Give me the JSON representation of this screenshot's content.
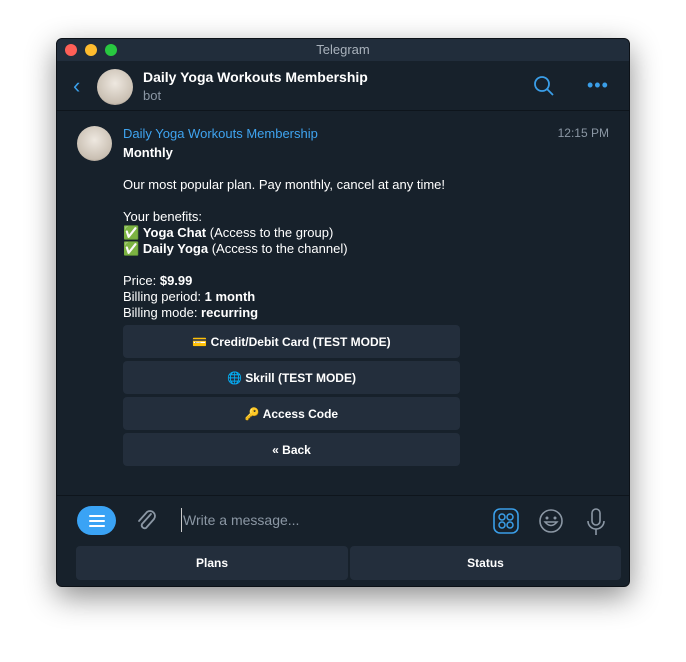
{
  "window": {
    "title": "Telegram"
  },
  "header": {
    "title": "Daily Yoga Workouts Membership",
    "subtitle": "bot"
  },
  "message": {
    "sender": "Daily Yoga Workouts Membership",
    "time": "12:15 PM",
    "title": "Monthly",
    "description": "Our most popular plan. Pay monthly, cancel at any time!",
    "benefits_label": "Your benefits:",
    "benefits": [
      {
        "icon": "✅",
        "name": "Yoga Chat",
        "detail": " (Access to the group)"
      },
      {
        "icon": "✅",
        "name": "Daily Yoga",
        "detail": " (Access to the channel)"
      }
    ],
    "price_label": "Price: ",
    "price": "$9.99",
    "period_label": "Billing period: ",
    "period": "1 month",
    "mode_label": "Billing mode: ",
    "mode": "recurring",
    "buttons": [
      "💳 Credit/Debit Card (TEST MODE)",
      "🌐 Skrill (TEST MODE)",
      "🔑 Access Code",
      "« Back"
    ]
  },
  "composer": {
    "placeholder": "Write a message..."
  },
  "reply_keyboard": [
    "Plans",
    "Status"
  ],
  "colors": {
    "accent": "#3aa3f5",
    "background": "#17212b",
    "button": "#232e3c"
  }
}
